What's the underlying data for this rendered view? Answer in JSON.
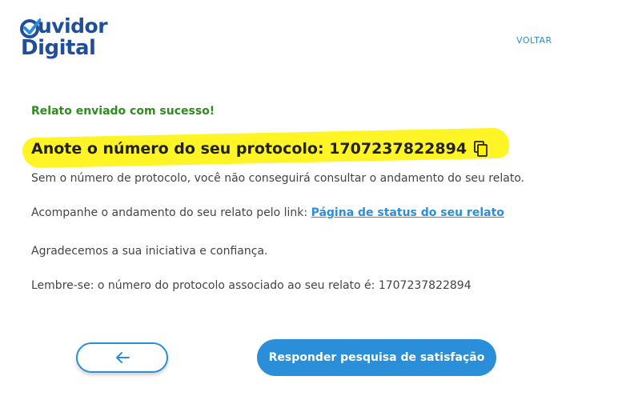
{
  "header": {
    "logo_line1": "uvidor",
    "logo_line2": "Digital",
    "back_link": "VOLTAR"
  },
  "content": {
    "success_message": "Relato enviado com sucesso!",
    "protocol_prefix": "Anote o número do seu protocolo:",
    "protocol_number": "1707237822894",
    "warning": "Sem o número de protocolo, você não conseguirá consultar o andamento do seu relato.",
    "follow_prefix": "Acompanhe o andamento do seu relato pelo link: ",
    "follow_link": "Página de status do seu relato",
    "thanks": "Agradecemos a sua iniciativa e confiança.",
    "reminder": "Lembre-se: o número do protocolo associado ao seu relato é: 1707237822894"
  },
  "actions": {
    "back_icon": "arrow-left-icon",
    "survey_button": "Responder pesquisa de satisfação"
  },
  "colors": {
    "brand": "#1f4e9a",
    "accent": "#2a8fd8",
    "success": "#2e8b1f",
    "highlight": "#fff200"
  }
}
